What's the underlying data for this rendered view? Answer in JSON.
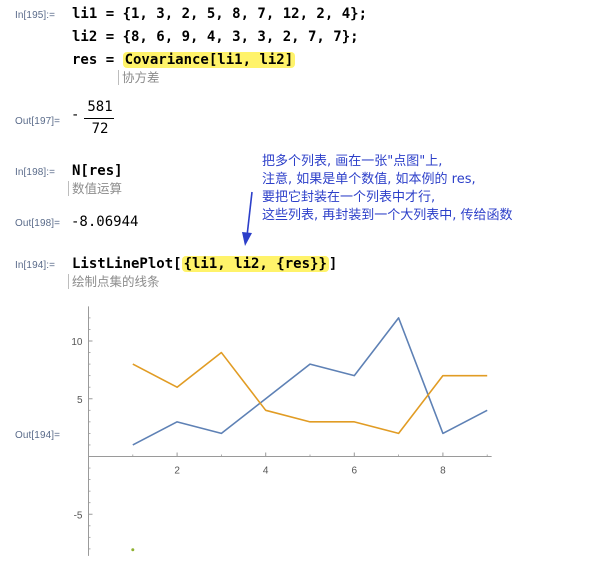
{
  "cells": {
    "in195": {
      "label": "In[195]:=",
      "line1": "li1 = {1, 3, 2, 5, 8, 7, 12, 2, 4};",
      "line2": "li2 = {8, 6, 9, 4, 3, 3, 2, 7, 7};",
      "line3_prefix": "res = ",
      "line3_highlight": "Covariance[li1, li2]",
      "comment": "协方差"
    },
    "out197": {
      "label": "Out[197]=",
      "sign": "-",
      "numerator": "581",
      "denominator": "72"
    },
    "in198": {
      "label": "In[198]:=",
      "code": "N[res]",
      "comment": "数值运算"
    },
    "out198": {
      "label": "Out[198]=",
      "value": "-8.06944"
    },
    "in194": {
      "label": "In[194]:=",
      "code_prefix": "ListLinePlot[",
      "code_highlight": "{li1, li2, {res}}",
      "code_suffix": "]",
      "comment": "绘制点集的线条"
    },
    "out194": {
      "label": "Out[194]="
    }
  },
  "annotation": {
    "lines": [
      "把多个列表, 画在一张\"点图\"上,",
      "注意, 如果是单个数值, 如本例的 res,",
      "要把它封装在一个列表中才行,",
      "这些列表, 再封装到一个大列表中, 传给函数"
    ],
    "color": "#2c3fc9"
  },
  "chart_data": {
    "type": "line",
    "x": [
      1,
      2,
      3,
      4,
      5,
      6,
      7,
      8,
      9
    ],
    "series": [
      {
        "values": [
          1,
          3,
          2,
          5,
          8,
          7,
          12,
          2,
          4
        ],
        "color": "#5e81b5"
      },
      {
        "values": [
          8,
          6,
          9,
          4,
          3,
          3,
          2,
          7,
          7
        ],
        "color": "#e19c24"
      },
      {
        "values": [
          -8.06944
        ],
        "x": [
          1
        ],
        "color": "#8fb131"
      }
    ],
    "xticks": [
      "2",
      "4",
      "6",
      "8"
    ],
    "yticks": [
      "10",
      "5",
      "-5"
    ],
    "xlim": [
      0,
      9.1
    ],
    "ylim": [
      -8.6,
      13
    ]
  }
}
